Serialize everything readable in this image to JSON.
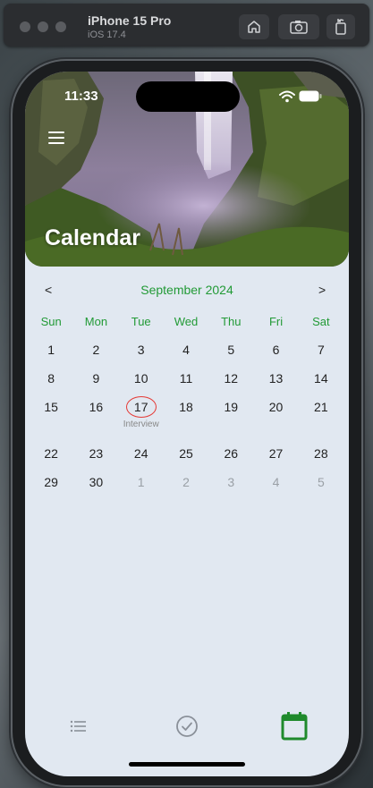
{
  "simulator": {
    "device_name": "iPhone 15 Pro",
    "os_version": "iOS 17.4",
    "buttons": [
      {
        "name": "home-icon"
      },
      {
        "name": "screenshot-icon"
      },
      {
        "name": "rotate-icon"
      }
    ]
  },
  "status_bar": {
    "time": "11:33"
  },
  "header": {
    "title": "Calendar",
    "menu_icon": "hamburger-menu-icon"
  },
  "calendar": {
    "month_label": "September 2024",
    "prev_label": "<",
    "next_label": ">",
    "weekdays": [
      "Sun",
      "Mon",
      "Tue",
      "Wed",
      "Thu",
      "Fri",
      "Sat"
    ],
    "weeks": [
      [
        {
          "d": "1"
        },
        {
          "d": "2"
        },
        {
          "d": "3"
        },
        {
          "d": "4"
        },
        {
          "d": "5"
        },
        {
          "d": "6"
        },
        {
          "d": "7"
        }
      ],
      [
        {
          "d": "8"
        },
        {
          "d": "9"
        },
        {
          "d": "10"
        },
        {
          "d": "11"
        },
        {
          "d": "12"
        },
        {
          "d": "13"
        },
        {
          "d": "14"
        }
      ],
      [
        {
          "d": "15"
        },
        {
          "d": "16"
        },
        {
          "d": "17",
          "event": "Interview"
        },
        {
          "d": "18"
        },
        {
          "d": "19"
        },
        {
          "d": "20"
        },
        {
          "d": "21"
        }
      ],
      [
        {
          "d": "22"
        },
        {
          "d": "23"
        },
        {
          "d": "24"
        },
        {
          "d": "25"
        },
        {
          "d": "26"
        },
        {
          "d": "27"
        },
        {
          "d": "28"
        }
      ],
      [
        {
          "d": "29"
        },
        {
          "d": "30"
        },
        {
          "d": "1",
          "other": true
        },
        {
          "d": "2",
          "other": true
        },
        {
          "d": "3",
          "other": true
        },
        {
          "d": "4",
          "other": true
        },
        {
          "d": "5",
          "other": true
        }
      ]
    ]
  },
  "tabs": [
    {
      "name": "list-icon",
      "active": false
    },
    {
      "name": "checkmark-circle-icon",
      "active": false
    },
    {
      "name": "calendar-icon",
      "active": true
    }
  ],
  "colors": {
    "accent": "#229a36",
    "event_marker": "#e53935",
    "screen_bg": "#e1e8f1"
  }
}
